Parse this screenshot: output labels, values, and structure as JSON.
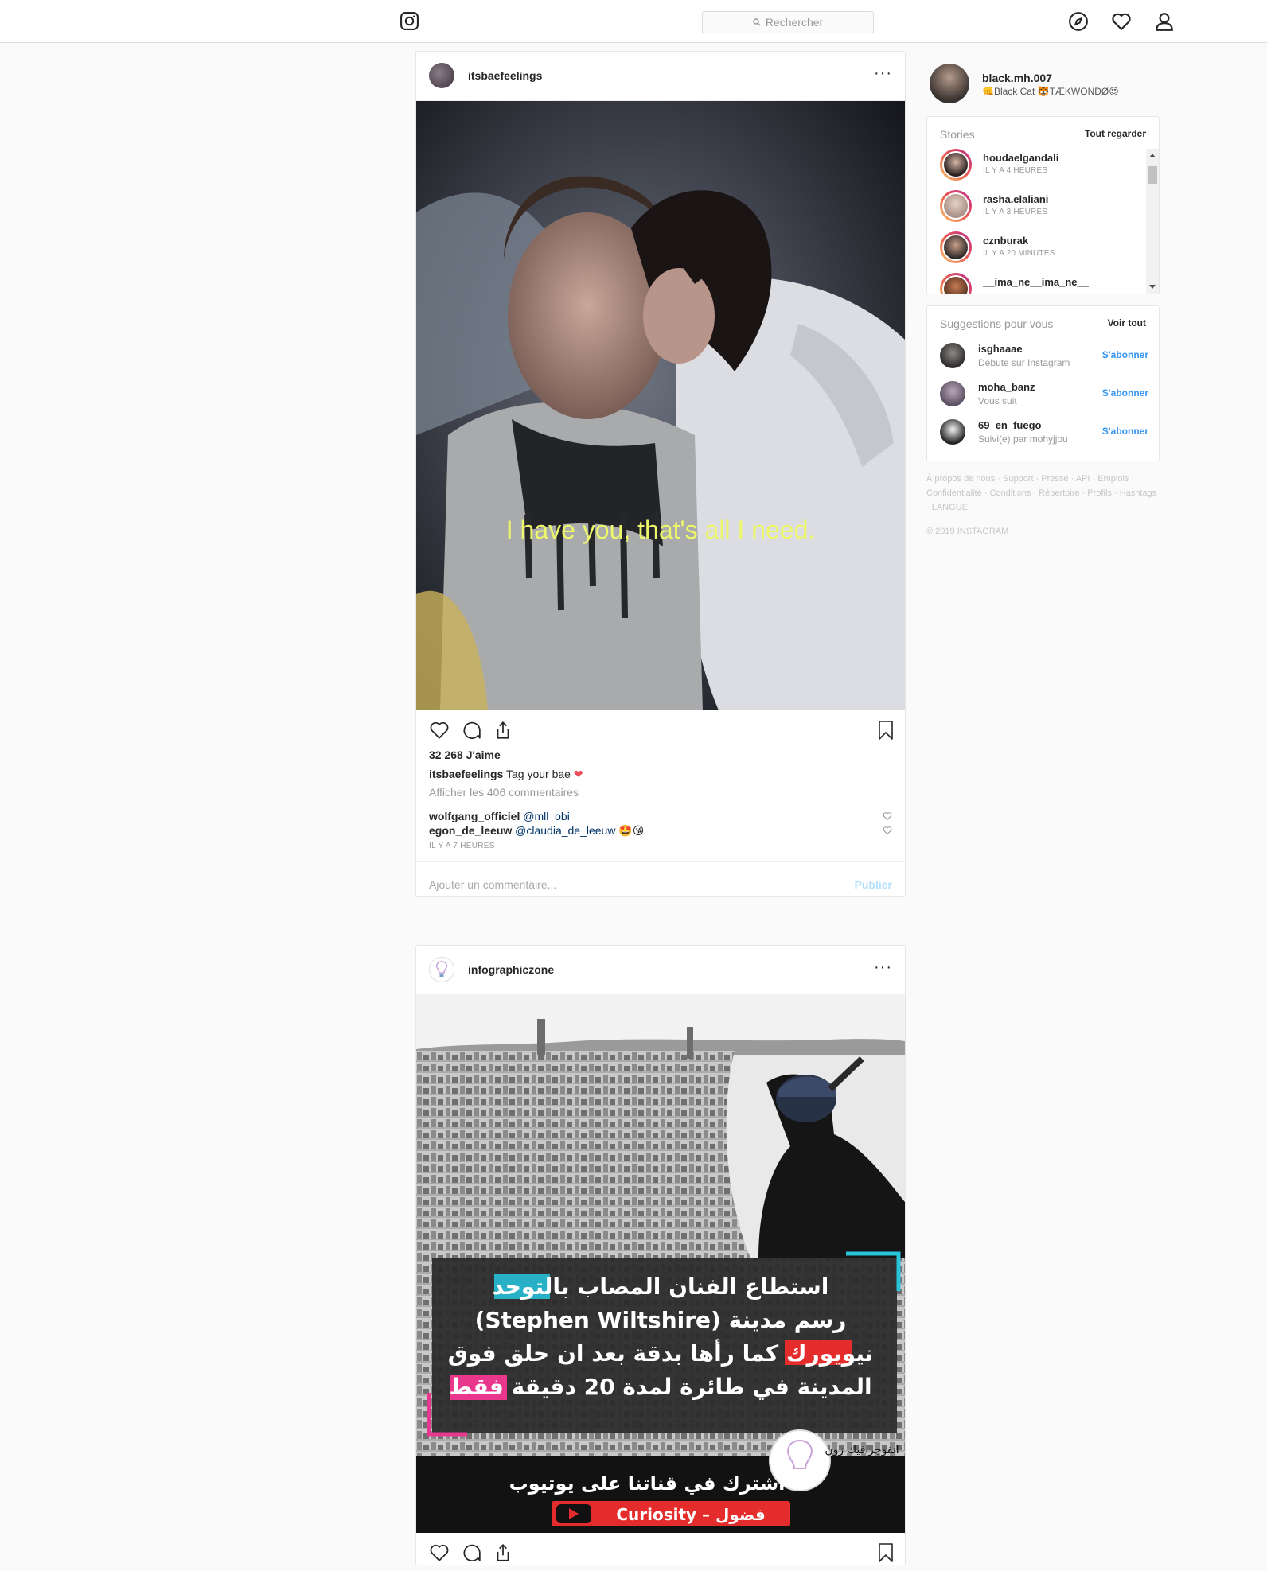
{
  "header": {
    "search_placeholder": "Rechercher"
  },
  "posts": [
    {
      "username": "itsbaefeelings",
      "image_overlay_text": "I have you, that's all I need.",
      "likes": "32 268 J'aime",
      "caption_user": "itsbaefeelings",
      "caption_text": "Tag your bae",
      "view_comments": "Afficher les 406 commentaires",
      "comments": [
        {
          "user": "wolfgang_officiel",
          "mention": "@mll_obi",
          "emoji": ""
        },
        {
          "user": "egon_de_leeuw",
          "mention": "@claudia_de_leeuw",
          "emoji": "🤩😘"
        }
      ],
      "timestamp": "IL Y A 7 HEURES",
      "comment_placeholder": "Ajouter un commentaire...",
      "publish_label": "Publier"
    },
    {
      "username": "infographiczone",
      "image_text": {
        "line1": "استطاع الفنان المصاب بالتوحد",
        "line2": "(Stephen Wiltshire) رسم مدينة",
        "line3": "نيويورك كما رأها بدقة بعد ان حلق فوق",
        "line4": "المدينة في طائرة لمدة 20 دقيقة فقط",
        "subscribe": "اشترك في قناتنا على يوتيوب",
        "channel": "Curiosity – فضول",
        "brand": "انفوجرافيك زون"
      }
    }
  ],
  "sidebar": {
    "me": {
      "username": "black.mh.007",
      "bio": "👊Black Cat 🐯TÆKWŌNDØ😍"
    },
    "stories": {
      "title": "Stories",
      "see_all": "Tout regarder",
      "items": [
        {
          "name": "houdaelgandali",
          "time": "IL Y A 4 HEURES"
        },
        {
          "name": "rasha.elaliani",
          "time": "IL Y A 3 HEURES"
        },
        {
          "name": "cznburak",
          "time": "IL Y A 20 MINUTES"
        },
        {
          "name": "__ima_ne__ima_ne__",
          "time": ""
        }
      ]
    },
    "suggestions": {
      "title": "Suggestions pour vous",
      "see_all": "Voir tout",
      "items": [
        {
          "name": "isghaaae",
          "sub": "Débute sur Instagram",
          "action": "S'abonner"
        },
        {
          "name": "moha_banz",
          "sub": "Vous suit",
          "action": "S'abonner"
        },
        {
          "name": "69_en_fuego",
          "sub": "Suivi(e) par mohyjjou",
          "action": "S'abonner"
        }
      ]
    },
    "footer_links": "À propos de nous · Support · Presse · API · Emplois · Confidentialité · Conditions · Répertoire · Profils · Hashtags · LANGUE",
    "copyright": "© 2019 INSTAGRAM"
  },
  "colors": {
    "accent": "#3897f0",
    "border": "#dbdbdb",
    "heart_red": "#ed4956"
  }
}
